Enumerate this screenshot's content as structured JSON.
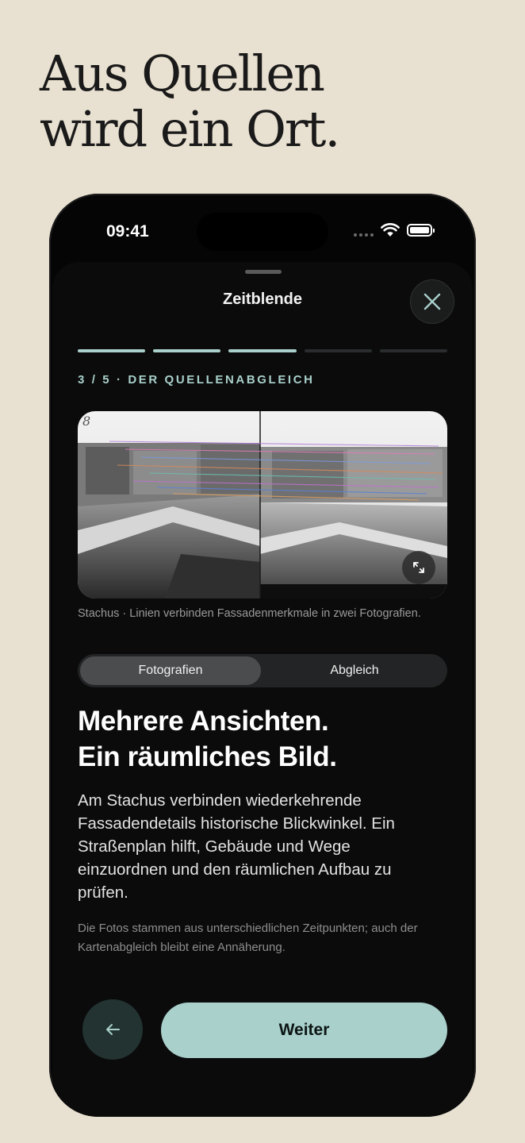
{
  "headline": {
    "line1": "Aus Quellen",
    "line2": "wird ein Ort."
  },
  "status_bar": {
    "time": "09:41"
  },
  "sheet": {
    "title": "Zeitblende",
    "progress": {
      "current": 3,
      "total": 5
    },
    "step_label": "3 / 5 · DER QUELLENABGLEICH",
    "image_caption": "Stachus · Linien verbinden Fassadenmerkmale in zwei Fotografien.",
    "segments": [
      "Fotografien",
      "Abgleich"
    ],
    "selected_segment": "Fotografien",
    "heading_line1": "Mehrere Ansichten.",
    "heading_line2": "Ein räumliches Bild.",
    "body": "Am Stachus verbinden wiederkehrende Fassadendetails historische Blickwinkel. Ein Straßenplan hilft, Gebäude und Wege einzuordnen und den räumlichen Aufbau zu prüfen.",
    "note": "Die Fotos stammen aus unterschiedlichen Zeitpunkten; auch der Kartenabgleich bleibt eine Annäherung.",
    "next_label": "Weiter"
  },
  "icons": {
    "close": "close-icon",
    "expand": "expand-icon",
    "back": "arrow-left-icon",
    "wifi": "wifi-icon",
    "battery": "battery-icon"
  },
  "colors": {
    "background": "#e8e0d0",
    "accent": "#a9d0cb",
    "sheet": "#0b0b0b"
  }
}
